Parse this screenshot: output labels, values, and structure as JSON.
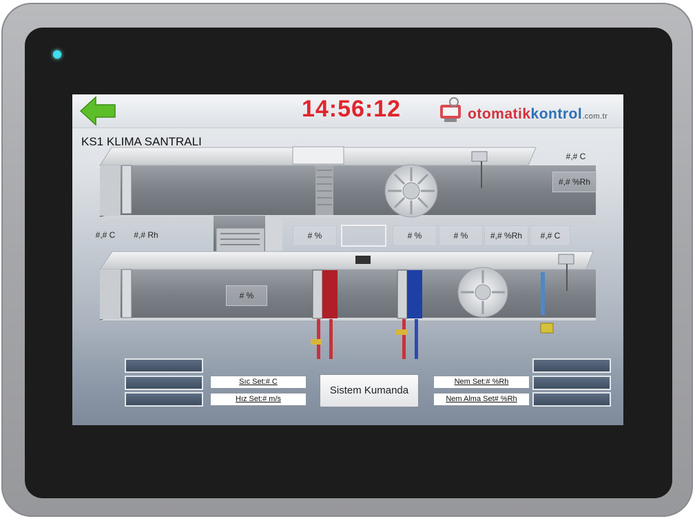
{
  "header": {
    "clock": "14:56:12",
    "logo": {
      "part1": "otomatik",
      "part2": "kontrol",
      "suffix": ".com.tr"
    }
  },
  "page_title": "KS1 KLIMA SANTRALI",
  "readouts": {
    "supply_temp": "#,# C",
    "supply_humidity": "#,# %Rh",
    "outdoor_temp": "#,# C",
    "outdoor_humidity": "#,# Rh",
    "damper_1": "# %",
    "damper_2": "# %",
    "damper_3": "# %",
    "mixing_damper": "# %",
    "return_humidity": "#,# %Rh",
    "return_temp": "#,# C"
  },
  "controls": {
    "heat_set": "Sıc Set:# C",
    "speed_set": "Hız Set:# m/s",
    "system_command": "Sistem Kumanda",
    "humidity_set": "Nem Set:# %Rh",
    "dehumidify_set": "Nem Alma Set# %Rh"
  },
  "icons": {
    "back": "left-arrow-icon",
    "led": "power-led-icon"
  },
  "colors": {
    "clock": "#e0262c",
    "back_arrow": "#5cbf2a",
    "led": "#3ee0ef",
    "field": "#4a586c",
    "heating_coil": "#b01f28",
    "cooling_coil": "#1e3fa6"
  }
}
